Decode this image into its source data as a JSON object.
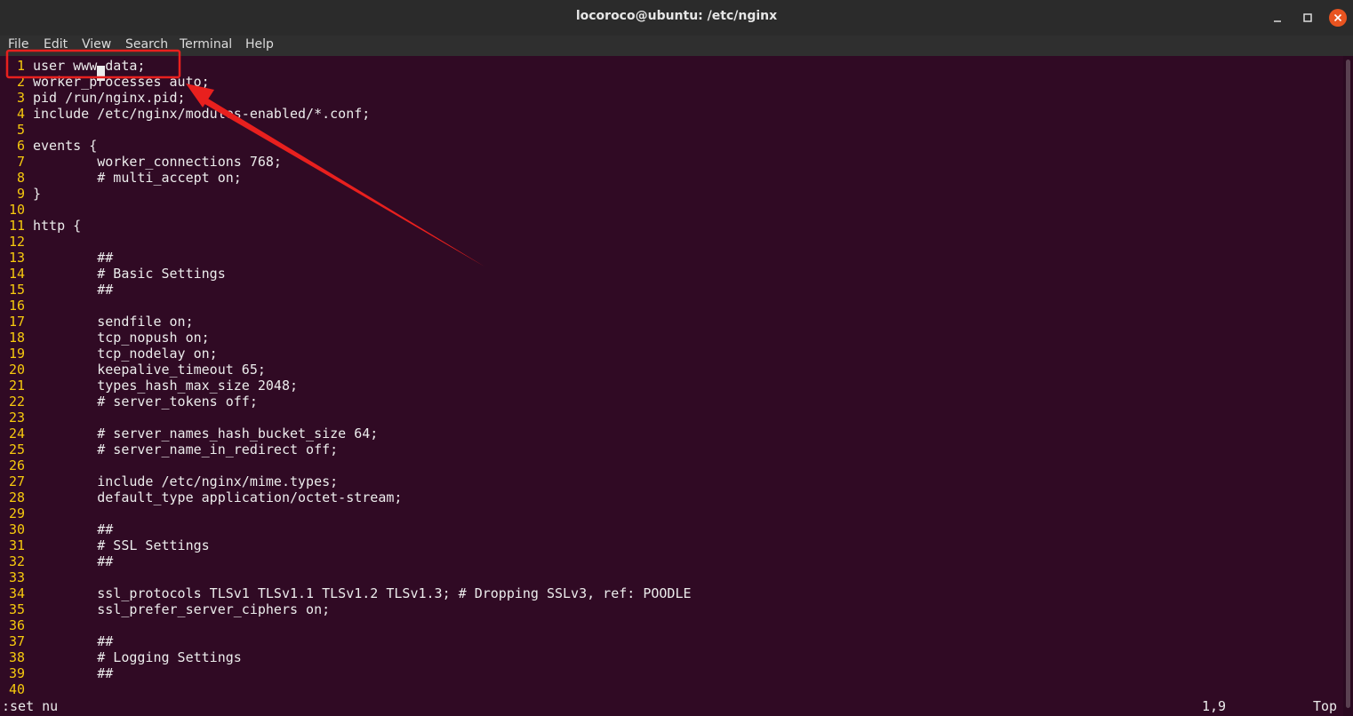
{
  "window": {
    "title": "locoroco@ubuntu: /etc/nginx",
    "buttons": [
      "minimize",
      "maximize",
      "close"
    ]
  },
  "menu": [
    "File",
    "Edit",
    "View",
    "Search",
    "Terminal",
    "Help"
  ],
  "editor": {
    "lines": [
      {
        "n": "1",
        "text": "user www-data;"
      },
      {
        "n": "2",
        "text": "worker_processes auto;"
      },
      {
        "n": "3",
        "text": "pid /run/nginx.pid;"
      },
      {
        "n": "4",
        "text": "include /etc/nginx/modules-enabled/*.conf;"
      },
      {
        "n": "5",
        "text": ""
      },
      {
        "n": "6",
        "text": "events {"
      },
      {
        "n": "7",
        "text": "        worker_connections 768;"
      },
      {
        "n": "8",
        "text": "        # multi_accept on;"
      },
      {
        "n": "9",
        "text": "}"
      },
      {
        "n": "10",
        "text": ""
      },
      {
        "n": "11",
        "text": "http {"
      },
      {
        "n": "12",
        "text": ""
      },
      {
        "n": "13",
        "text": "        ##"
      },
      {
        "n": "14",
        "text": "        # Basic Settings"
      },
      {
        "n": "15",
        "text": "        ##"
      },
      {
        "n": "16",
        "text": ""
      },
      {
        "n": "17",
        "text": "        sendfile on;"
      },
      {
        "n": "18",
        "text": "        tcp_nopush on;"
      },
      {
        "n": "19",
        "text": "        tcp_nodelay on;"
      },
      {
        "n": "20",
        "text": "        keepalive_timeout 65;"
      },
      {
        "n": "21",
        "text": "        types_hash_max_size 2048;"
      },
      {
        "n": "22",
        "text": "        # server_tokens off;"
      },
      {
        "n": "23",
        "text": ""
      },
      {
        "n": "24",
        "text": "        # server_names_hash_bucket_size 64;"
      },
      {
        "n": "25",
        "text": "        # server_name_in_redirect off;"
      },
      {
        "n": "26",
        "text": ""
      },
      {
        "n": "27",
        "text": "        include /etc/nginx/mime.types;"
      },
      {
        "n": "28",
        "text": "        default_type application/octet-stream;"
      },
      {
        "n": "29",
        "text": ""
      },
      {
        "n": "30",
        "text": "        ##"
      },
      {
        "n": "31",
        "text": "        # SSL Settings"
      },
      {
        "n": "32",
        "text": "        ##"
      },
      {
        "n": "33",
        "text": ""
      },
      {
        "n": "34",
        "text": "        ssl_protocols TLSv1 TLSv1.1 TLSv1.2 TLSv1.3; # Dropping SSLv3, ref: POODLE"
      },
      {
        "n": "35",
        "text": "        ssl_prefer_server_ciphers on;"
      },
      {
        "n": "36",
        "text": ""
      },
      {
        "n": "37",
        "text": "        ##"
      },
      {
        "n": "38",
        "text": "        # Logging Settings"
      },
      {
        "n": "39",
        "text": "        ##"
      },
      {
        "n": "40",
        "text": ""
      }
    ],
    "command": ":set nu",
    "position": "1,9",
    "scroll": "Top"
  },
  "colors": {
    "terminal_bg": "#300a24",
    "line_number": "#f6c90e",
    "annotation": "#e8201e",
    "close_button": "#e95420"
  }
}
